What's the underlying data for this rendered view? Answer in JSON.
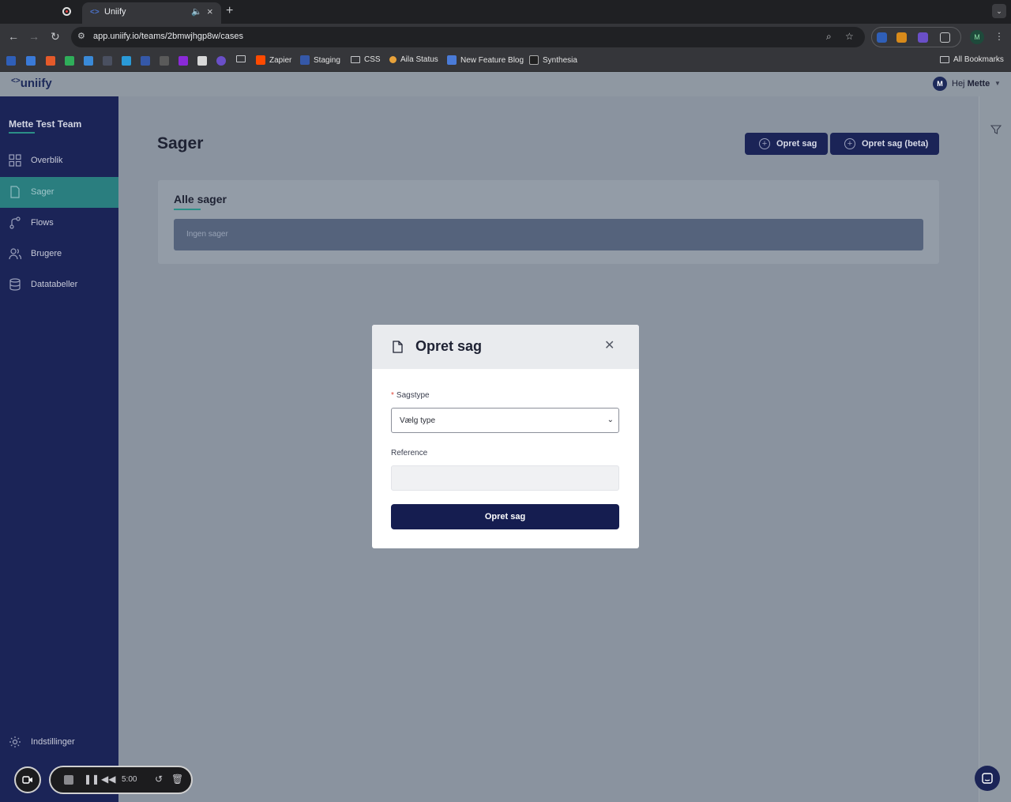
{
  "browser": {
    "tab_title": "Uniify",
    "url": "app.uniify.io/teams/2bmwjhgp8w/cases",
    "bookmarks": [
      {
        "label": "Zapier",
        "color": "#ff4a00"
      },
      {
        "label": "Staging",
        "color": "#3558a8"
      },
      {
        "label": "CSS",
        "color": "folder"
      },
      {
        "label": "Aila Status",
        "color": "#e8a23a"
      },
      {
        "label": "New Feature Blog",
        "color": "#4a7bd8"
      },
      {
        "label": "Synthesia",
        "color": "#202020"
      }
    ],
    "all_bookmarks": "All Bookmarks",
    "profile_initial": "M"
  },
  "app": {
    "logo": "uniify",
    "user": {
      "greeting": "Hej",
      "name": "Mette",
      "initial": "M"
    }
  },
  "sidebar": {
    "team_name": "Mette Test Team",
    "items": [
      {
        "label": "Overblik",
        "icon": "grid-icon"
      },
      {
        "label": "Sager",
        "icon": "document-icon",
        "active": true
      },
      {
        "label": "Flows",
        "icon": "flow-icon"
      },
      {
        "label": "Brugere",
        "icon": "users-icon"
      },
      {
        "label": "Datatabeller",
        "icon": "database-icon"
      }
    ],
    "settings_label": "Indstillinger"
  },
  "main": {
    "title": "Sager",
    "create_button": "Opret sag",
    "create_beta_button": "Opret sag (beta)",
    "card_title": "Alle sager",
    "empty_text": "Ingen sager"
  },
  "modal": {
    "title": "Opret sag",
    "type_label": "Sagstype",
    "type_selected": "Vælg type",
    "reference_label": "Reference",
    "reference_value": "",
    "submit_label": "Opret sag"
  },
  "recorder": {
    "time": "5:00"
  },
  "colors": {
    "sidebar": "#1b2457",
    "accent": "#2a7e7f",
    "primary_button": "#151d50"
  }
}
